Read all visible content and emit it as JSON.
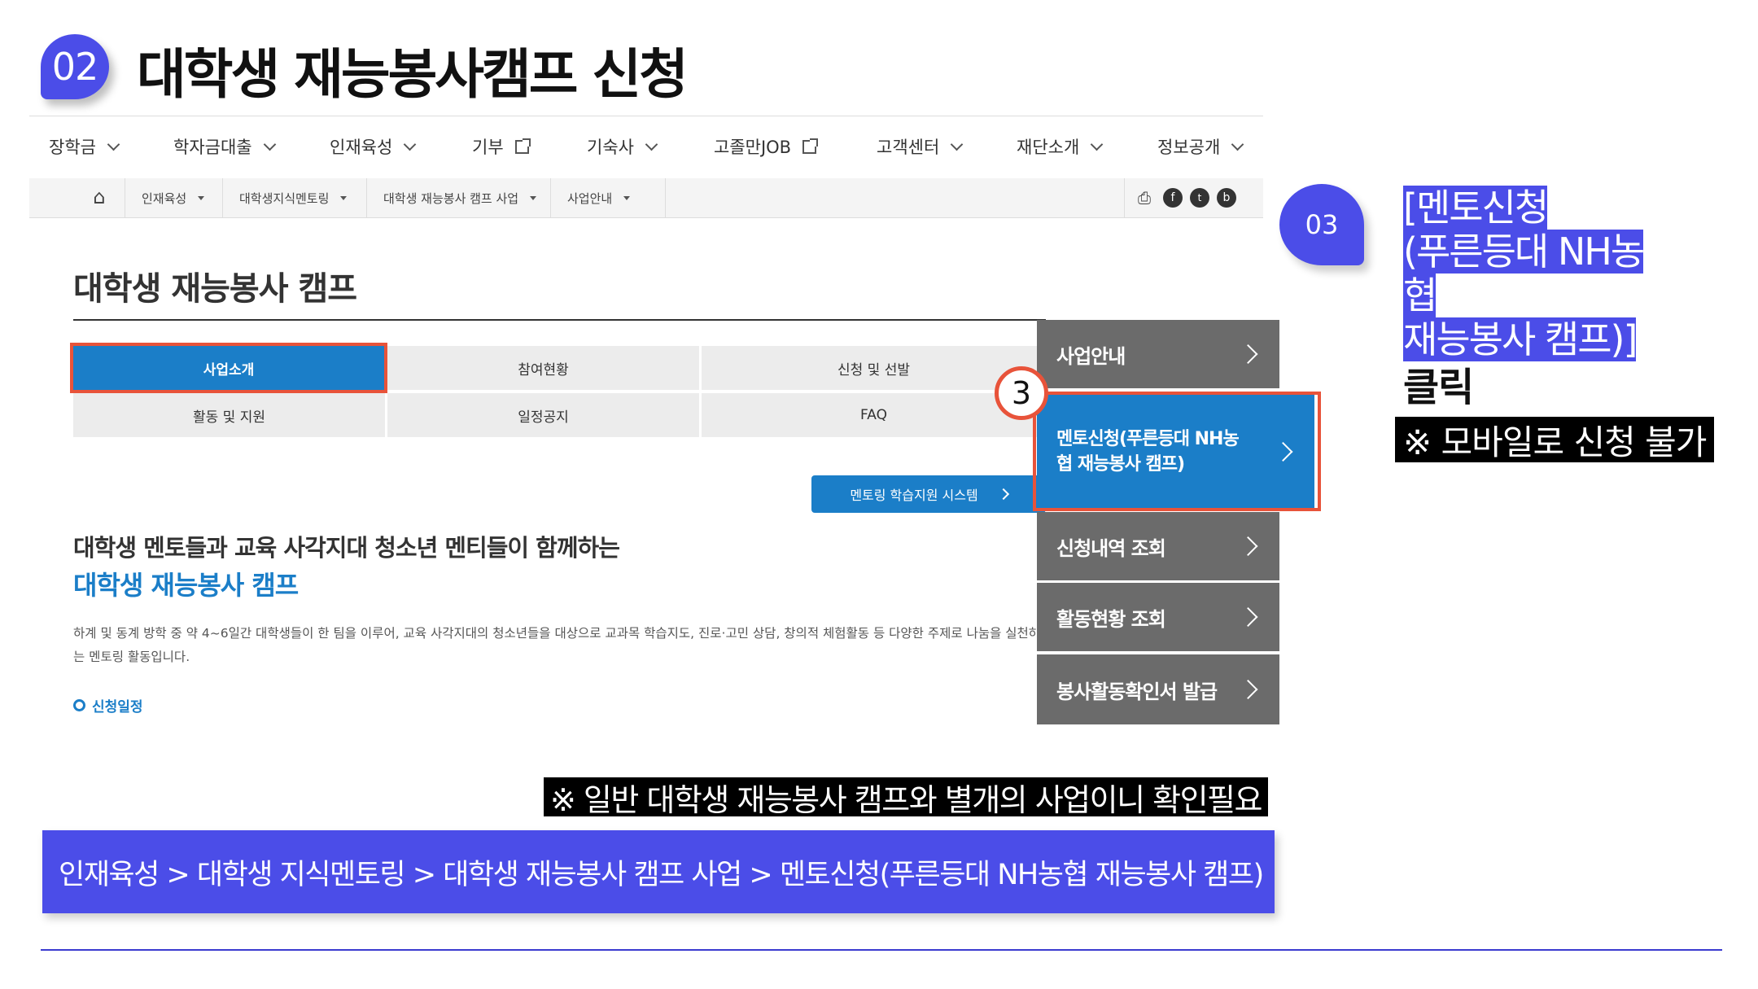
{
  "slide": {
    "step_number": "02",
    "title": "대학생 재능봉사캠프 신청"
  },
  "gnb": {
    "items": [
      {
        "label": "장학금",
        "icon": "chevron-down-icon"
      },
      {
        "label": "학자금대출",
        "icon": "chevron-down-icon"
      },
      {
        "label": "인재육성",
        "icon": "chevron-down-icon"
      },
      {
        "label": "기부",
        "icon": "external-link-icon"
      },
      {
        "label": "기숙사",
        "icon": "chevron-down-icon"
      },
      {
        "label": "고졸만JOB",
        "icon": "external-link-icon"
      },
      {
        "label": "고객센터",
        "icon": "chevron-down-icon"
      },
      {
        "label": "재단소개",
        "icon": "chevron-down-icon"
      },
      {
        "label": "정보공개",
        "icon": "chevron-down-icon"
      }
    ]
  },
  "breadcrumb": {
    "home_icon": "⌂",
    "items": [
      "인재육성",
      "대학생지식멘토링",
      "대학생 재능봉사 캠프 사업",
      "사업안내"
    ],
    "utility_icons": [
      "print-icon",
      "facebook-icon",
      "twitter-icon",
      "blog-icon"
    ]
  },
  "page": {
    "heading": "대학생 재능봉사 캠프",
    "tabs": [
      {
        "label": "사업소개",
        "active": true
      },
      {
        "label": "참여현황",
        "active": false
      },
      {
        "label": "신청 및 선발",
        "active": false
      },
      {
        "label": "활동 및 지원",
        "active": false
      },
      {
        "label": "일정공지",
        "active": false
      },
      {
        "label": "FAQ",
        "active": false
      }
    ],
    "system_button": "멘토링 학습지원 시스템",
    "intro_line1": "대학생 멘토들과 교육 사각지대 청소년 멘티들이 함께하는",
    "intro_line2": "대학생 재능봉사 캠프",
    "description": "하계 및 동계 방학 중 약 4~6일간 대학생들이 한 팀을 이루어, 교육 사각지대의 청소년들을 대상으로 교과목 학습지도, 진로·고민 상담, 창의적 체험활동 등 다양한 주제로 나눔을 실천하는 멘토링 활동입니다.",
    "schedule_label": "신청일정"
  },
  "side_menu": {
    "items": [
      {
        "label": "사업안내",
        "active": false
      },
      {
        "label": "멘토신청(푸른등대 NH농협 재능봉사 캠프)",
        "active": true
      },
      {
        "label": "신청내역 조회",
        "active": false
      },
      {
        "label": "활동현황 조회",
        "active": false
      },
      {
        "label": "봉사활동확인서 발급",
        "active": false
      }
    ]
  },
  "callouts": {
    "marker_number": "3",
    "step_badge": "03",
    "mentor_note_line1": "[멘토신청",
    "mentor_note_line2": "(푸른등대 NH농협",
    "mentor_note_line3": "재능봉사 캠프)]",
    "click": "클릭",
    "mobile_note": "※ 모바일로 신청 불가",
    "separate_note": "※ 일반 대학생 재능봉사 캠프와 별개의 사업이니 확인필요",
    "path": "인재육성 > 대학생 지식멘토링 > 대학생 재능봉사 캠프 사업 > 멘토신청(푸른등대 NH농협 재능봉사 캠프)"
  },
  "colors": {
    "accent_purple": "#4b4de8",
    "site_blue": "#1b7ec8",
    "highlight_red": "#e8533a",
    "side_menu_gray": "#6b6b6b"
  }
}
